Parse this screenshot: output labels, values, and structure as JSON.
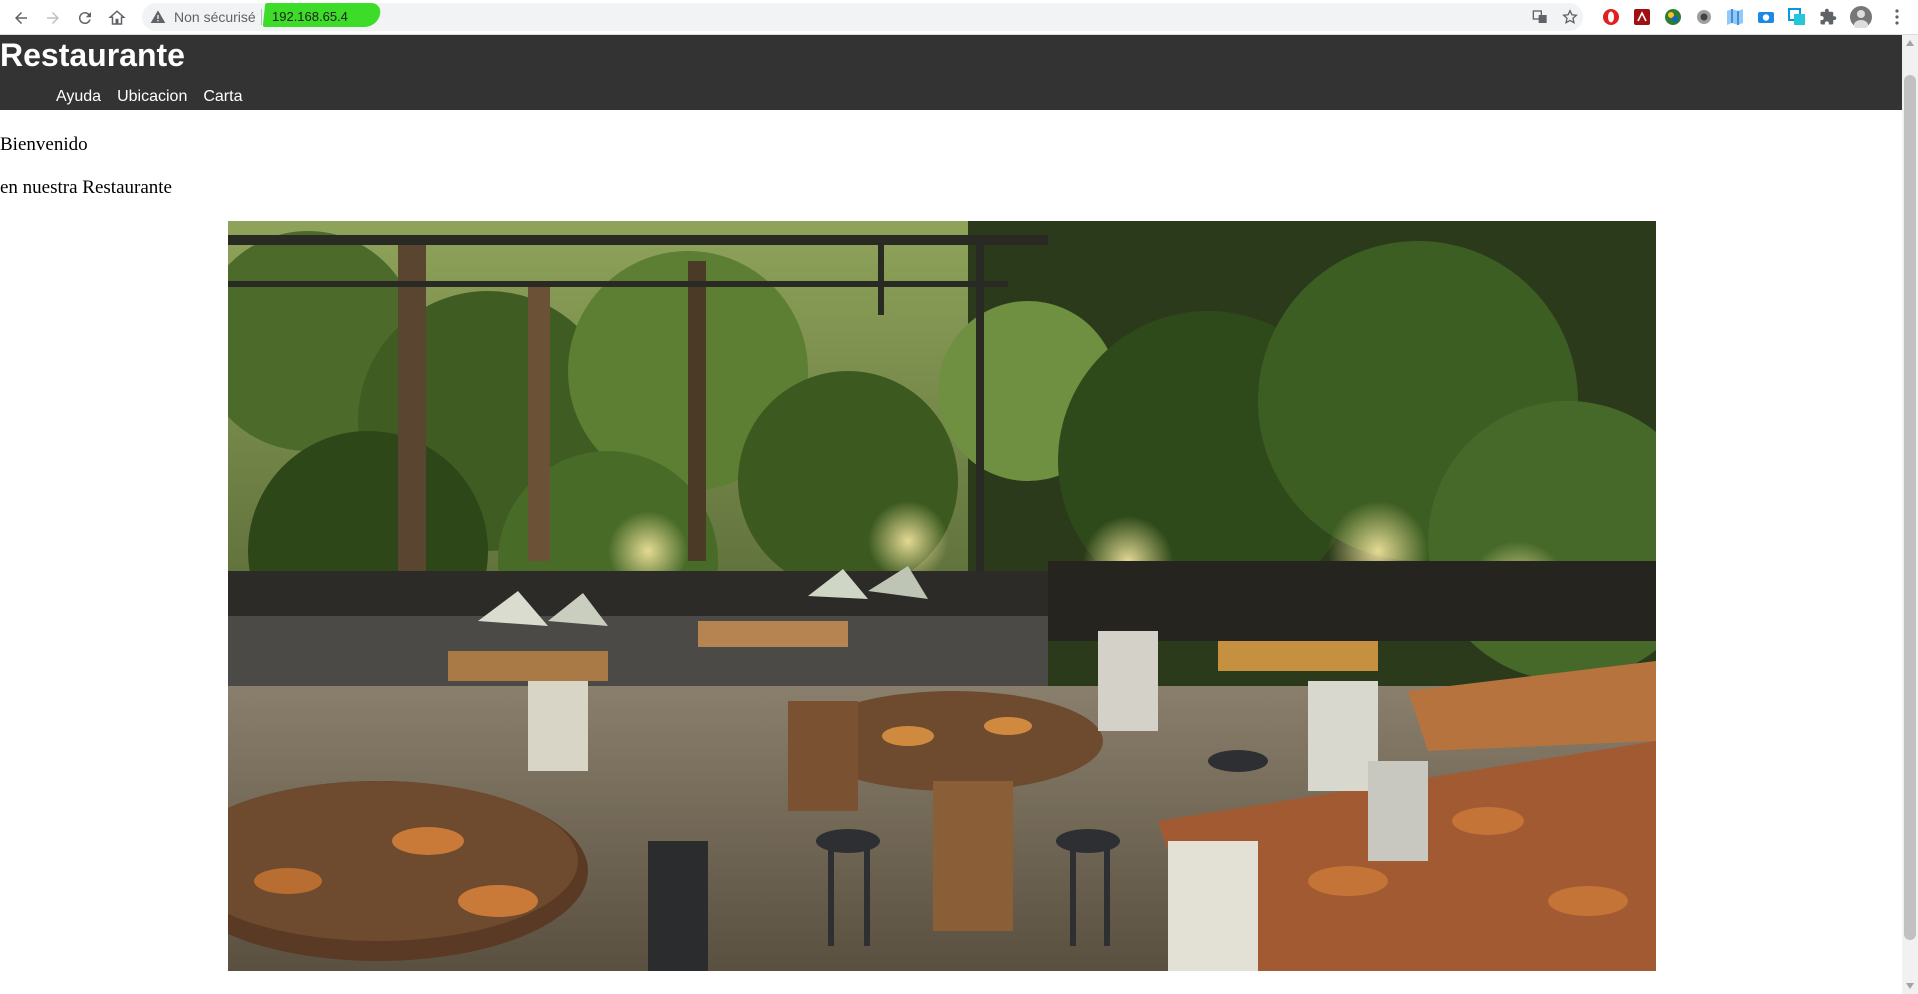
{
  "browser": {
    "security_label": "Non sécurisé",
    "url": "192.168.65.4",
    "highlight_color": "#3ddc28"
  },
  "site": {
    "title": "Restaurante",
    "header_bg": "#333333",
    "nav": [
      {
        "label": "Ayuda"
      },
      {
        "label": "Ubicacion"
      },
      {
        "label": "Carta"
      }
    ],
    "welcome": "Bienvenido",
    "subtitle": "en nuestra Restaurante"
  }
}
